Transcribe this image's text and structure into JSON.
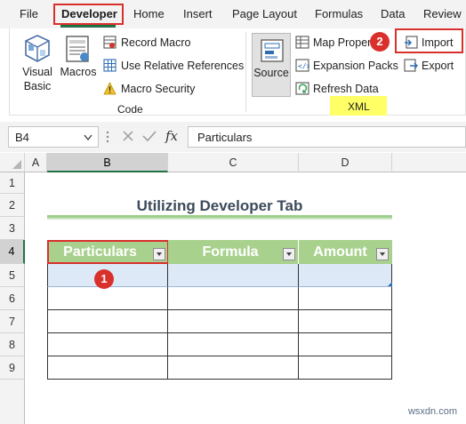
{
  "menu": {
    "file": "File",
    "developer": "Developer",
    "home": "Home",
    "insert": "Insert",
    "page_layout": "Page Layout",
    "formulas": "Formulas",
    "data": "Data",
    "review": "Review"
  },
  "ribbon": {
    "code": {
      "visual_basic_1": "Visual",
      "visual_basic_2": "Basic",
      "macros": "Macros",
      "record_macro": "Record Macro",
      "relative_refs": "Use Relative References",
      "macro_security": "Macro Security",
      "group_label": "Code"
    },
    "xml": {
      "source": "Source",
      "map_properties": "Map Proper",
      "expansion_packs": "Expansion Packs",
      "refresh_data": "Refresh Data",
      "import": "Import",
      "export": "Export",
      "group_label": "XML"
    }
  },
  "formula_bar": {
    "name_box": "B4",
    "fx": "fx",
    "content": "Particulars"
  },
  "grid": {
    "columns": [
      "A",
      "B",
      "C",
      "D"
    ],
    "rows": [
      "1",
      "2",
      "3",
      "4",
      "5",
      "6",
      "7",
      "8",
      "9"
    ],
    "title": "Utilizing Developer Tab",
    "headers": [
      "Particulars",
      "Formula",
      "Amount"
    ]
  },
  "badges": {
    "one": "1",
    "two": "2"
  },
  "watermark": "wsxdn.com",
  "colors": {
    "accent_green": "#217346",
    "header_fill": "#a9d18e",
    "title_text": "#3c4a5a",
    "callout_red": "#d9302c",
    "highlight_yellow": "#ffff66"
  }
}
